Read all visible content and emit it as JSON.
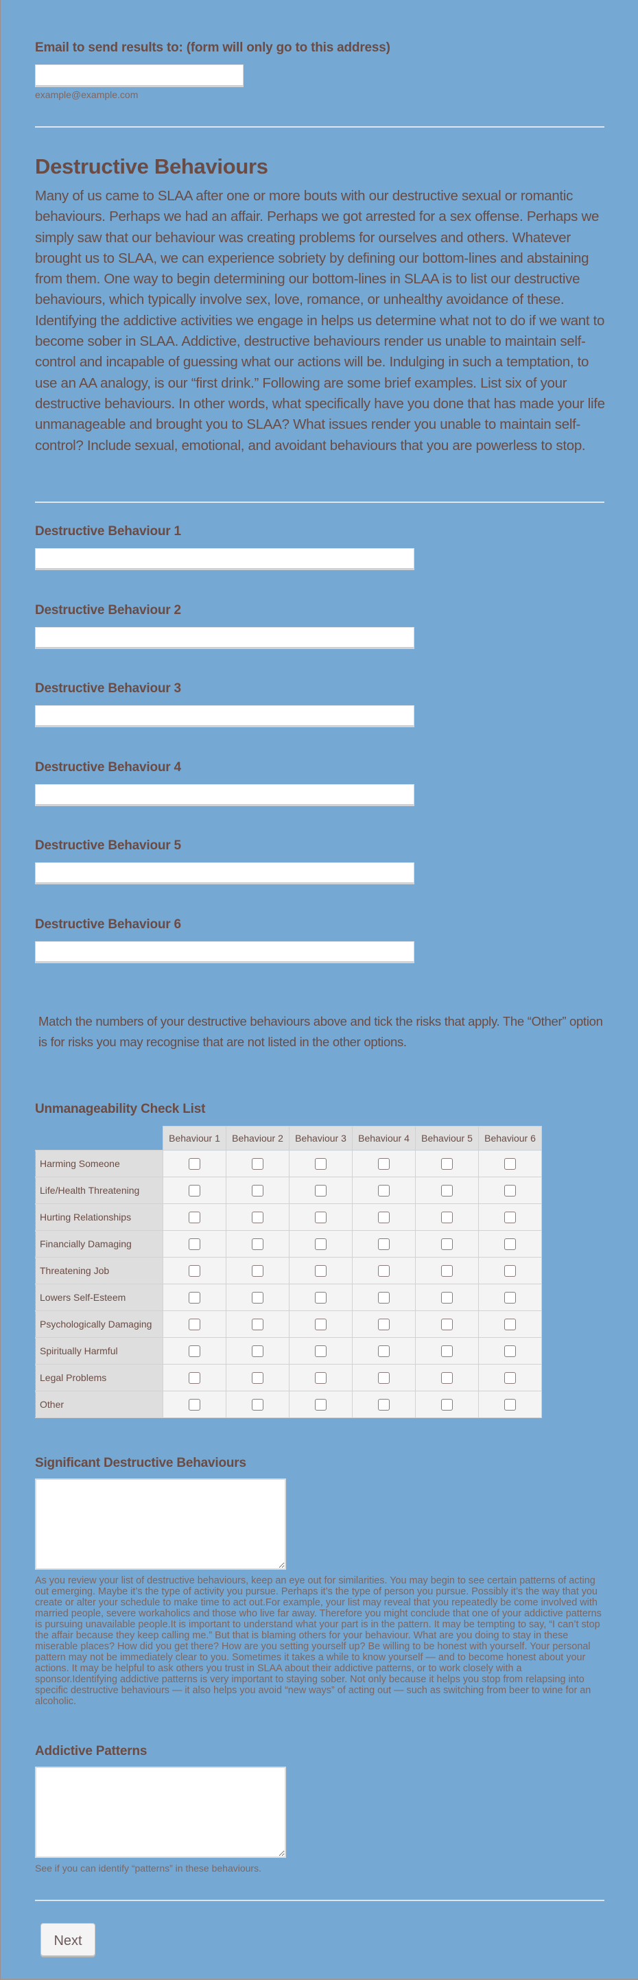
{
  "email": {
    "label": "Email to send results to: (form will only go to this address)",
    "value": "",
    "hint": "example@example.com"
  },
  "section": {
    "title": "Destructive Behaviours",
    "intro": "Many of us came to SLAA after one or more bouts with our destructive sexual or romantic behaviours. Perhaps we had an affair. Perhaps we got arrested for a sex offense. Perhaps we simply saw that our behaviour was creating problems for ourselves and others. Whatever brought us to SLAA, we can experience sobriety by defining our bottom-lines and abstaining from them. One way to begin determining our bottom-lines in SLAA is to list our destructive behaviours, which typically involve sex, love, romance, or unhealthy avoidance of these. Identifying the addictive activities we engage in helps us determine what not to do if we want to become sober in SLAA. Addictive, destructive behaviours render us unable to maintain self-control and incapable of guessing what our actions will be. Indulging in such a temptation, to use an AA analogy, is our “first drink.” Following are some brief examples. List six of your destructive behaviours. In other words, what specifically have you done that has made your life unmanageable and brought you to SLAA? What issues render you unable to maintain self-control? Include sexual, emotional, and avoidant behaviours that you are powerless to stop."
  },
  "behaviours": [
    {
      "label": "Destructive Behaviour 1",
      "value": ""
    },
    {
      "label": "Destructive Behaviour 2",
      "value": ""
    },
    {
      "label": "Destructive Behaviour 3",
      "value": ""
    },
    {
      "label": "Destructive Behaviour 4",
      "value": ""
    },
    {
      "label": "Destructive Behaviour 5",
      "value": ""
    },
    {
      "label": "Destructive Behaviour 6",
      "value": ""
    }
  ],
  "match_text": "Match the numbers of your destructive behaviours above and tick the risks that apply. The “Other” option is for risks you may recognise that are not listed in the other options.",
  "checklist": {
    "title": "Unmanageability Check List",
    "columns": [
      "Behaviour 1",
      "Behaviour 2",
      "Behaviour 3",
      "Behaviour 4",
      "Behaviour 5",
      "Behaviour 6"
    ],
    "rows": [
      "Harming Someone",
      "Life/Health Threatening",
      "Hurting Relationships",
      "Financially Damaging",
      "Threatening Job",
      "Lowers Self-Esteem",
      "Psychologically Damaging",
      "Spiritually Harmful",
      "Legal Problems",
      "Other"
    ],
    "checked": []
  },
  "significant": {
    "label": "Significant Destructive Behaviours",
    "value": "",
    "hint": "As you review your list of destructive behaviours, keep an eye out for similarities. You may begin to see certain patterns of acting out emerging. Maybe it’s the type of activity you pursue. Perhaps it’s the type of person you pursue. Possibly it’s the way that you create or alter your schedule to make time to act out.For example, your list may reveal that you repeatedly be come involved with married people, severe workaholics and those who live far away. Therefore you might conclude that one of your addictive patterns is pursuing unavailable people.It is important to understand what your part is in the pattern. It may be tempting to say, “I can’t stop the affair because they keep calling me.” But that is blaming others for your behaviour. What are you doing to stay in these miserable places? How did you get there? How are you setting yourself up? Be willing to be honest with yourself. Your personal pattern may not be immediately clear to you. Sometimes it takes a while to know yourself — and to become honest about your actions. It may be helpful to ask others you trust in SLAA about their addictive patterns, or to work closely with a sponsor.Identifying addictive patterns is very important to staying sober. Not only because it helps you stop from relapsing into specific destructive behaviours — it also helps you avoid “new ways” of acting out — such as switching from beer to wine for an alcoholic."
  },
  "patterns": {
    "label": "Addictive Patterns",
    "value": "",
    "hint": "See if you can identify “patterns” in these behaviours."
  },
  "buttons": {
    "next": "Next"
  }
}
